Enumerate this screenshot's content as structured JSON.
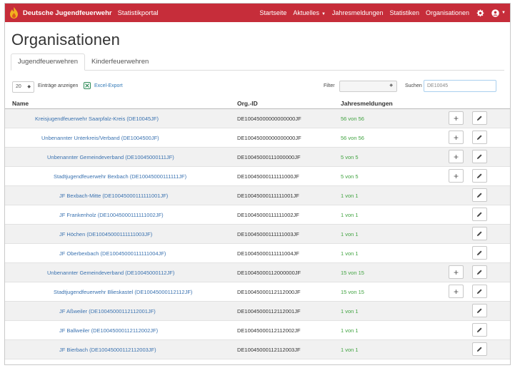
{
  "navbar": {
    "brand": "Deutsche Jugendfeuerwehr",
    "subtitle": "Statistikportal",
    "links": [
      "Startseite",
      "Aktuelles",
      "Jahresmeldungen",
      "Statistiken",
      "Organisationen"
    ],
    "accent": "#c62d3a"
  },
  "page": {
    "title": "Organisationen",
    "tabs": [
      "Jugendfeuerwehren",
      "Kinderfeuerwehren"
    ]
  },
  "toolbar": {
    "page_length": "20",
    "page_length_label": "Einträge anzeigen",
    "excel_label": "Excel-Export",
    "filter_label": "Filter",
    "filter_value": "",
    "search_label": "Suchen",
    "search_value": "DE10045"
  },
  "table": {
    "columns": [
      "Name",
      "Org.-ID",
      "Jahresmeldungen"
    ],
    "rows": [
      {
        "name": "Kreisjugendfeuerwehr Saarpfalz-Kreis (DE10045JF)",
        "org_id": "DE10045000000000000JF",
        "reports": "56 von 56",
        "level": 0,
        "add": true
      },
      {
        "name": "Unbenannter Unterkreis/Verband (DE1004500JF)",
        "org_id": "DE10045000000000000JF",
        "reports": "56 von 56",
        "level": 1,
        "add": true
      },
      {
        "name": "Unbenannter Gemeindeverband (DE10045000111JF)",
        "org_id": "DE10045000111000000JF",
        "reports": "5 von 5",
        "level": 2,
        "add": true
      },
      {
        "name": "Stadtjugendfeuerwehr Bexbach (DE10045000111111JF)",
        "org_id": "DE10045000111111000JF",
        "reports": "5 von 5",
        "level": 3,
        "add": true
      },
      {
        "name": "JF Bexbach-Mitte (DE10045000111111001JF)",
        "org_id": "DE10045000111111001JF",
        "reports": "1 von 1",
        "level": 4,
        "add": false
      },
      {
        "name": "JF Frankenholz (DE10045000111111002JF)",
        "org_id": "DE10045000111111002JF",
        "reports": "1 von 1",
        "level": 4,
        "add": false
      },
      {
        "name": "JF Höchen (DE10045000111111003JF)",
        "org_id": "DE10045000111111003JF",
        "reports": "1 von 1",
        "level": 4,
        "add": false
      },
      {
        "name": "JF Oberbexbach (DE10045000111111004JF)",
        "org_id": "DE10045000111111004JF",
        "reports": "1 von 1",
        "level": 4,
        "add": false
      },
      {
        "name": "Unbenannter Gemeindeverband (DE10045000112JF)",
        "org_id": "DE10045000112000000JF",
        "reports": "15 von 15",
        "level": 2,
        "add": true
      },
      {
        "name": "Stadtjugendfeuerwehr Blieskastel (DE10045000112112JF)",
        "org_id": "DE10045000112112000JF",
        "reports": "15 von 15",
        "level": 3,
        "add": true
      },
      {
        "name": "JF Aßweiler (DE10045000112112001JF)",
        "org_id": "DE10045000112112001JF",
        "reports": "1 von 1",
        "level": 4,
        "add": false
      },
      {
        "name": "JF Ballweiler (DE10045000112112002JF)",
        "org_id": "DE10045000112112002JF",
        "reports": "1 von 1",
        "level": 4,
        "add": false
      },
      {
        "name": "JF Bierbach (DE10045000112112003JF)",
        "org_id": "DE10045000112112003JF",
        "reports": "1 von 1",
        "level": 4,
        "add": false
      }
    ]
  },
  "icons": {
    "add": "plus-icon",
    "edit": "pencil-icon",
    "settings": "gear-icon",
    "user": "user-icon",
    "excel": "excel-icon"
  }
}
